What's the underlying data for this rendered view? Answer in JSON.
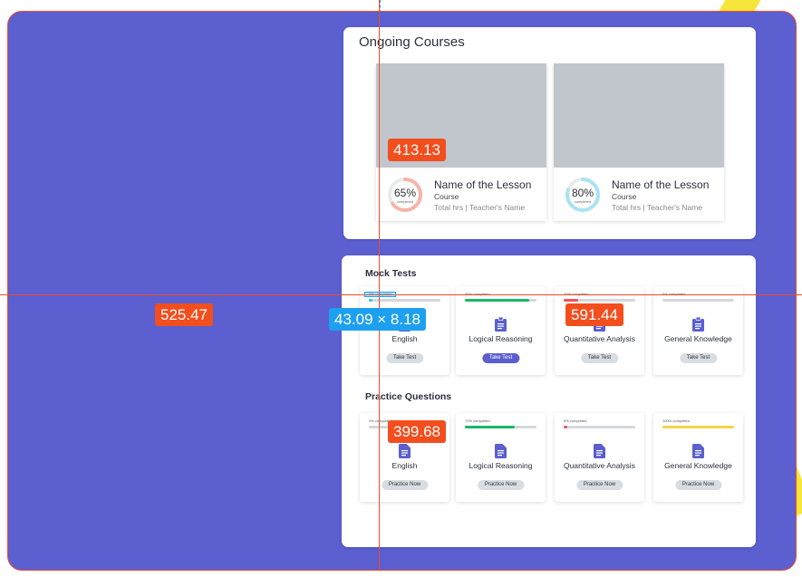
{
  "colors": {
    "frame": "#5b5fcf",
    "accent": "#5b5fcf",
    "measure_red": "#f24e1e",
    "measure_blue": "#1ea0f0"
  },
  "ongoing": {
    "title": "Ongoing Courses",
    "courses": [
      {
        "percent": "65%",
        "percent_value": 65,
        "completed": "completed",
        "name": "Name of the Lesson",
        "type": "Course",
        "meta": "Total hrs | Teacher's Name",
        "ring_color": "#f7b3a9"
      },
      {
        "percent": "80%",
        "percent_value": 80,
        "completed": "completed",
        "name": "Name of the Lesson",
        "type": "Course",
        "meta": "Total hrs | Teacher's Name",
        "ring_color": "#a9e3f2"
      }
    ]
  },
  "mock_tests": {
    "title": "Mock Tests",
    "items": [
      {
        "progress_text": "5% completed",
        "progress": 5,
        "color": "#2ec4e6",
        "name": "English",
        "button": "Take Test",
        "primary": false
      },
      {
        "progress_text": "90% completed",
        "progress": 90,
        "color": "#19b86b",
        "name": "Logical Reasoning",
        "button": "Take Test",
        "primary": true
      },
      {
        "progress_text": "20% completed",
        "progress": 20,
        "color": "#f2525d",
        "name": "Quantitative Analysis",
        "button": "Take Test",
        "primary": false
      },
      {
        "progress_text": "0% completed",
        "progress": 0,
        "color": "#f5d54a",
        "name": "General Knowledge",
        "button": "Take Test",
        "primary": false
      }
    ]
  },
  "practice": {
    "title": "Practice Questions",
    "items": [
      {
        "progress_text": "0% completed",
        "progress": 0,
        "color": "#2ec4e6",
        "name": "English",
        "button": "Practice Now"
      },
      {
        "progress_text": "70% completed",
        "progress": 70,
        "color": "#19b86b",
        "name": "Logical Reasoning",
        "button": "Practice Now"
      },
      {
        "progress_text": "5% completed",
        "progress": 5,
        "color": "#f2525d",
        "name": "Quantitative Analysis",
        "button": "Practice Now"
      },
      {
        "progress_text": "100% completed",
        "progress": 100,
        "color": "#f5d54a",
        "name": "General Knowledge",
        "button": "Practice Now"
      }
    ]
  },
  "measurements": {
    "m1": "413.13",
    "m2": "525.47",
    "m3": "591.44",
    "m4": "399.68",
    "size": "43.09 × 8.18",
    "tiny": "5% completed"
  }
}
